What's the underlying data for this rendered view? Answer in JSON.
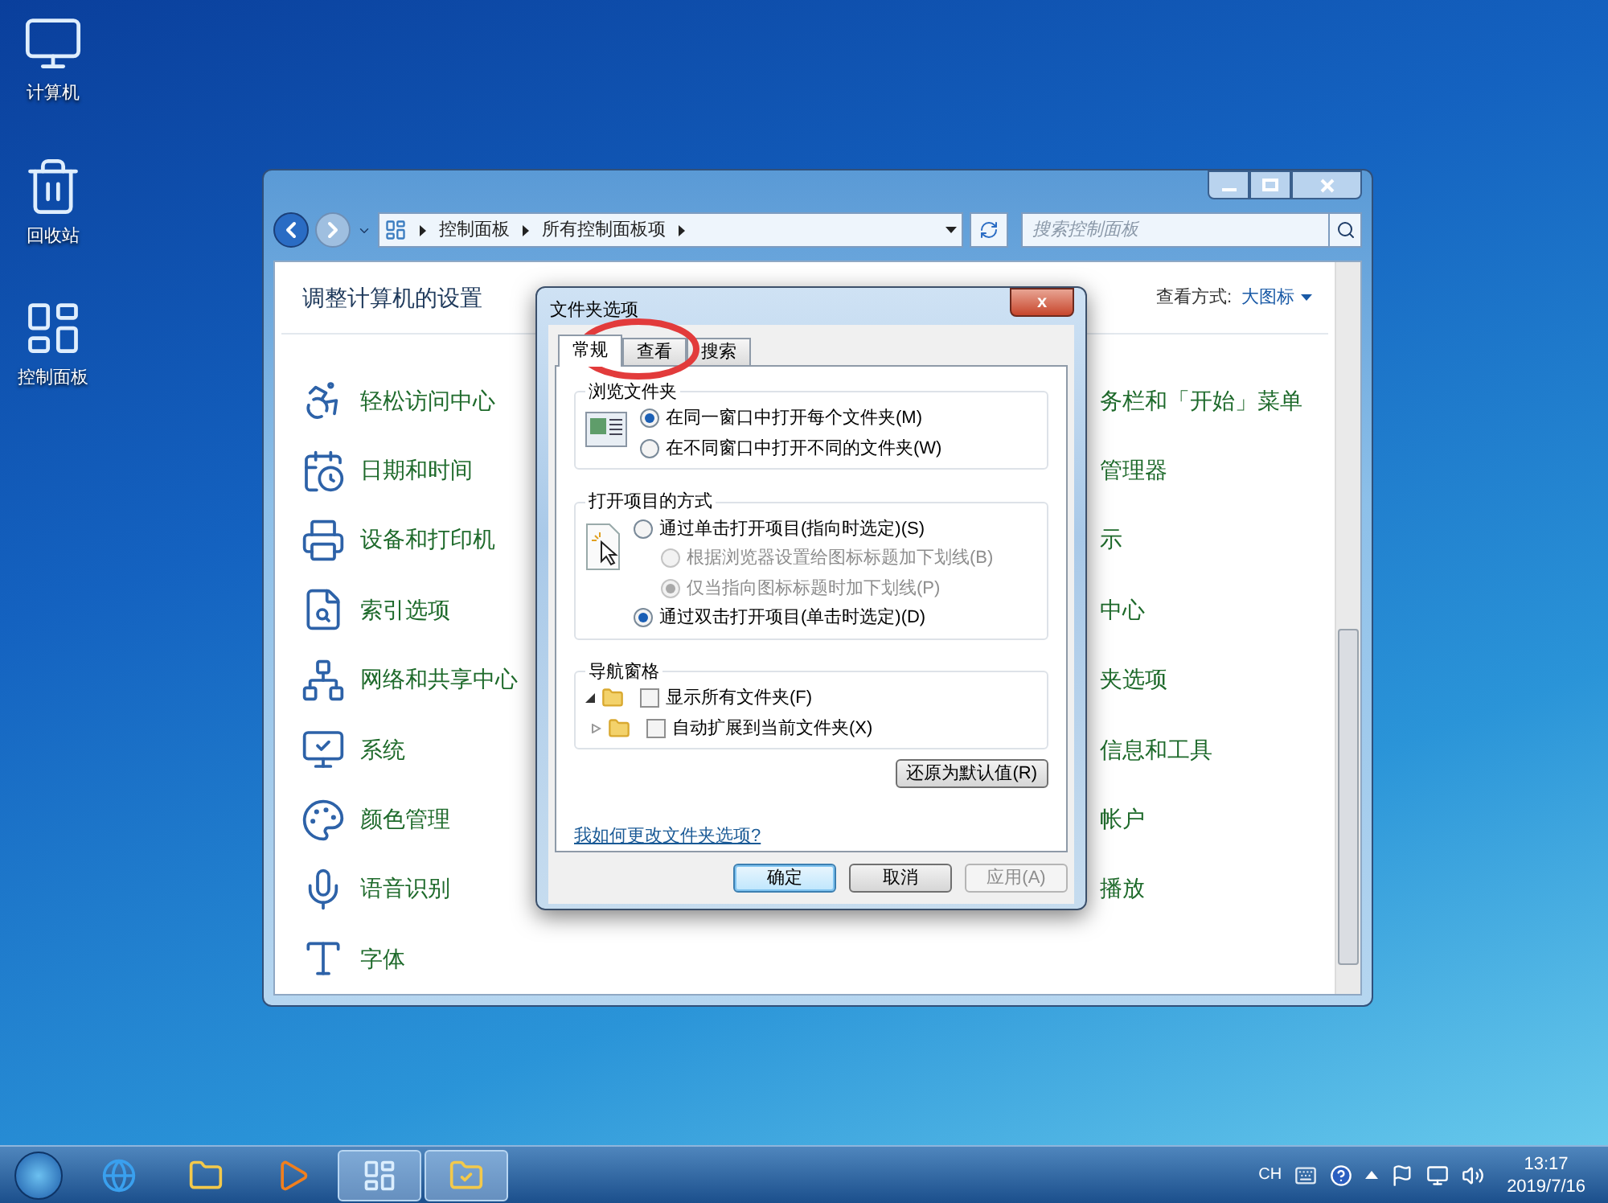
{
  "desktop_icons": [
    {
      "label": "计算机"
    },
    {
      "label": "回收站"
    },
    {
      "label": "控制面板"
    }
  ],
  "control_panel": {
    "breadcrumbs": [
      "控制面板",
      "所有控制面板项"
    ],
    "search": {
      "placeholder": "搜索控制面板"
    },
    "heading": "调整计算机的设置",
    "view_by_label": "查看方式:",
    "view_by_value": "大图标",
    "items_left": [
      "轻松访问中心",
      "日期和时间",
      "设备和打印机",
      "索引选项",
      "网络和共享中心",
      "系统",
      "颜色管理",
      "语音识别",
      "字体"
    ],
    "items_right": [
      "务栏和「开始」菜单",
      "管理器",
      "示",
      "中心",
      "夹选项",
      "信息和工具",
      "帐户",
      "播放"
    ]
  },
  "dialog": {
    "title": "文件夹选项",
    "close": "x",
    "tabs": [
      {
        "label": "常规",
        "selected": true
      },
      {
        "label": "查看",
        "selected": false
      },
      {
        "label": "搜索",
        "selected": false
      }
    ],
    "groups": [
      {
        "title": "浏览文件夹",
        "kind": "radios",
        "options": [
          {
            "label": "在同一窗口中打开每个文件夹(M)",
            "selected": true,
            "disabled": false
          },
          {
            "label": "在不同窗口中打开不同的文件夹(W)",
            "selected": false,
            "disabled": false
          }
        ]
      },
      {
        "title": "打开项目的方式",
        "kind": "radios",
        "options": [
          {
            "label": "通过单击打开项目(指向时选定)(S)",
            "selected": false,
            "disabled": false,
            "children": [
              {
                "label": "根据浏览器设置给图标标题加下划线(B)",
                "selected": false,
                "disabled": true
              },
              {
                "label": "仅当指向图标标题时加下划线(P)",
                "selected": true,
                "disabled": true
              }
            ]
          },
          {
            "label": "通过双击打开项目(单击时选定)(D)",
            "selected": true,
            "disabled": false
          }
        ]
      },
      {
        "title": "导航窗格",
        "kind": "checkboxes",
        "options": [
          {
            "label": "显示所有文件夹(F)",
            "checked": false,
            "expanded": true
          },
          {
            "label": "自动扩展到当前文件夹(X)",
            "checked": false,
            "expanded": false
          }
        ]
      }
    ],
    "restore_button": "还原为默认值(R)",
    "help_link": "我如何更改文件夹选项?",
    "buttons": [
      {
        "label": "确定",
        "disabled": false,
        "default": true
      },
      {
        "label": "取消",
        "disabled": false,
        "default": false
      },
      {
        "label": "应用(A)",
        "disabled": true,
        "default": false
      }
    ]
  },
  "taskbar": {
    "apps": [
      {
        "kind": "ie",
        "selected": false
      },
      {
        "kind": "explorer",
        "selected": false
      },
      {
        "kind": "media",
        "selected": false
      },
      {
        "kind": "control",
        "selected": true
      },
      {
        "kind": "folder",
        "selected": true
      }
    ],
    "language": "CH",
    "time": "13:17",
    "date": "2019/7/16"
  }
}
